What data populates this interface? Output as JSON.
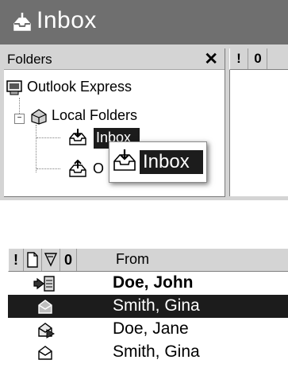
{
  "window": {
    "title": "Inbox",
    "title_icon": "inbox-tray-icon"
  },
  "folders_pane": {
    "header_label": "Folders",
    "close_glyph": "✕",
    "tree": [
      {
        "label": "Outlook Express",
        "icon": "outlook-express-icon",
        "level": 0
      },
      {
        "label": "Local Folders",
        "icon": "local-folders-icon",
        "level": 1,
        "expander": "−"
      },
      {
        "label": "Inbox",
        "icon": "inbox-tray-icon",
        "level": 2,
        "selected": true
      },
      {
        "label": "O",
        "icon": "outbox-icon",
        "level": 2,
        "partially_hidden": true
      }
    ]
  },
  "drag_ghost": {
    "label": "Inbox",
    "icon": "inbox-tray-icon"
  },
  "message_header_mini": {
    "priority_glyph": "!",
    "attachment_glyph": "0"
  },
  "message_list": {
    "columns": {
      "priority": "!",
      "document_icon": "document-icon",
      "flag_icon": "flag-icon",
      "attachment": "0",
      "from": "From"
    },
    "rows": [
      {
        "from": "Doe, John",
        "icon": "reply-arrow-envelope-icon",
        "unread": true,
        "selected": false
      },
      {
        "from": "Smith, Gina",
        "icon": "open-envelope-icon",
        "unread": false,
        "selected": true
      },
      {
        "from": "Doe, Jane",
        "icon": "forwarded-envelope-icon",
        "unread": false,
        "selected": false
      },
      {
        "from": "Smith, Gina",
        "icon": "open-envelope-icon",
        "unread": false,
        "selected": false
      }
    ]
  }
}
